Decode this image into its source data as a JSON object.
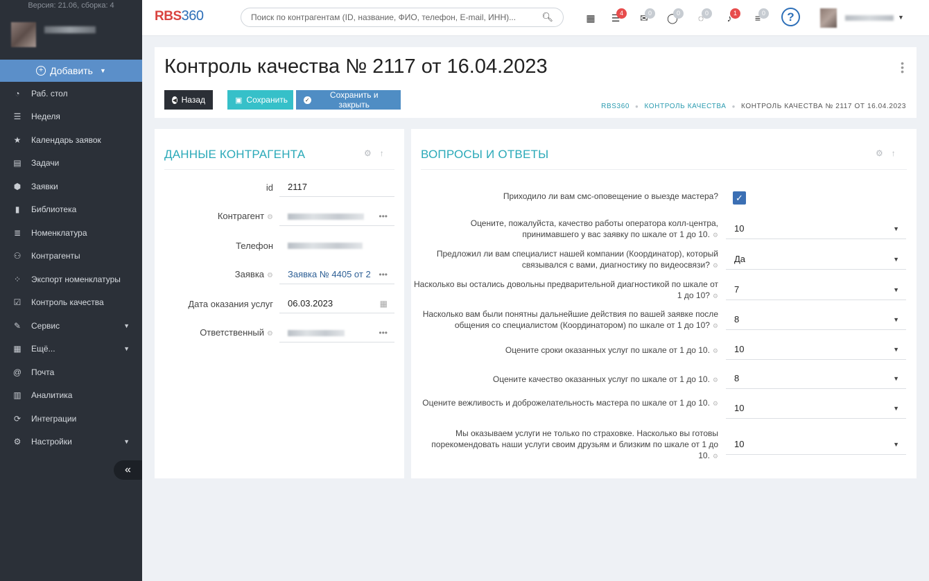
{
  "sidebar": {
    "version": "Версия: 21.06, сборка: 4",
    "add_label": "Добавить",
    "items": [
      {
        "label": "Раб. стол",
        "icon": "pie-chart-icon",
        "glyph": "◔"
      },
      {
        "label": "Неделя",
        "icon": "bars-icon",
        "glyph": "☰"
      },
      {
        "label": "Календарь заявок",
        "icon": "star-icon",
        "glyph": "★"
      },
      {
        "label": "Задачи",
        "icon": "list-icon",
        "glyph": "▤"
      },
      {
        "label": "Заявки",
        "icon": "hexagon-icon",
        "glyph": "⬢"
      },
      {
        "label": "Библиотека",
        "icon": "book-icon",
        "glyph": "▮"
      },
      {
        "label": "Номенклатура",
        "icon": "list-lines-icon",
        "glyph": "≣"
      },
      {
        "label": "Контрагенты",
        "icon": "users-icon",
        "glyph": "⚇"
      },
      {
        "label": "Экспорт номенклатуры",
        "icon": "spinner-icon",
        "glyph": "⁘"
      },
      {
        "label": "Контроль качества",
        "icon": "check-square-icon",
        "glyph": "☑"
      },
      {
        "label": "Сервис",
        "icon": "wrench-icon",
        "glyph": "✎"
      },
      {
        "label": "Ещё...",
        "icon": "grid-icon",
        "glyph": "▦"
      },
      {
        "label": "Почта",
        "icon": "at-icon",
        "glyph": "@"
      },
      {
        "label": "Аналитика",
        "icon": "bar-chart-icon",
        "glyph": "▥"
      },
      {
        "label": "Интеграции",
        "icon": "refresh-icon",
        "glyph": "⟳"
      },
      {
        "label": "Настройки",
        "icon": "gear-icon",
        "glyph": "⚙"
      }
    ]
  },
  "topbar": {
    "logo_text": "RBS",
    "logo_num": "360",
    "search_placeholder": "Поиск по контрагентам (ID, название, ФИО, телефон, E-mail, ИНН)...",
    "badges": [
      "4",
      "0",
      "0",
      "0",
      "1",
      "0"
    ],
    "help": "?"
  },
  "header": {
    "title": "Контроль качества № 2117 от 16.04.2023",
    "back": "Назад",
    "save": "Сохранить",
    "save_close": "Сохранить и закрыть",
    "breadcrumb": [
      "RBS360",
      "Контроль качества",
      "Контроль качества № 2117 от 16.04.2023"
    ]
  },
  "contractor": {
    "title": "Данные контрагента",
    "fields": {
      "id_label": "id",
      "id_value": "2117",
      "contractor_label": "Контрагент",
      "phone_label": "Телефон",
      "order_label": "Заявка",
      "order_value": "Заявка № 4405 от 2",
      "date_label": "Дата оказания услуг",
      "date_value": "06.03.2023",
      "responsible_label": "Ответственный"
    }
  },
  "qa": {
    "title": "Вопросы и ответы",
    "q1": "Приходило ли вам смс-оповещение о выезде мастера?",
    "q2": "Оцените, пожалуйста, качество работы оператора колл-центра, принимавшего у вас заявку по шкале от 1 до 10.",
    "a2": "10",
    "q3": "Предложил ли вам специалист нашей компании (Координатор), который связывался с вами, диагностику по видеосвязи?",
    "a3": "Да",
    "q4": "Насколько вы остались довольны предварительной диагностикой по шкале от 1 до 10?",
    "a4": "7",
    "q5": "Насколько вам были понятны дальнейшие действия по вашей заявке после общения со специалистом (Координатором) по шкале от 1 до 10?",
    "a5": "8",
    "q6": "Оцените сроки оказанных услуг по шкале от 1 до 10.",
    "a6": "10",
    "q7": "Оцените качество оказанных услуг по шкале от 1 до 10.",
    "a7": "8",
    "q8": "Оцените вежливость и доброжелательность мастера по шкале от 1 до 10.",
    "a8": "10",
    "q9": "Мы оказываем услуги не только по страховке. Насколько вы готовы порекомендовать наши услуги своим друзьям и близким по шкале от 1 до 10.",
    "a9": "10"
  }
}
